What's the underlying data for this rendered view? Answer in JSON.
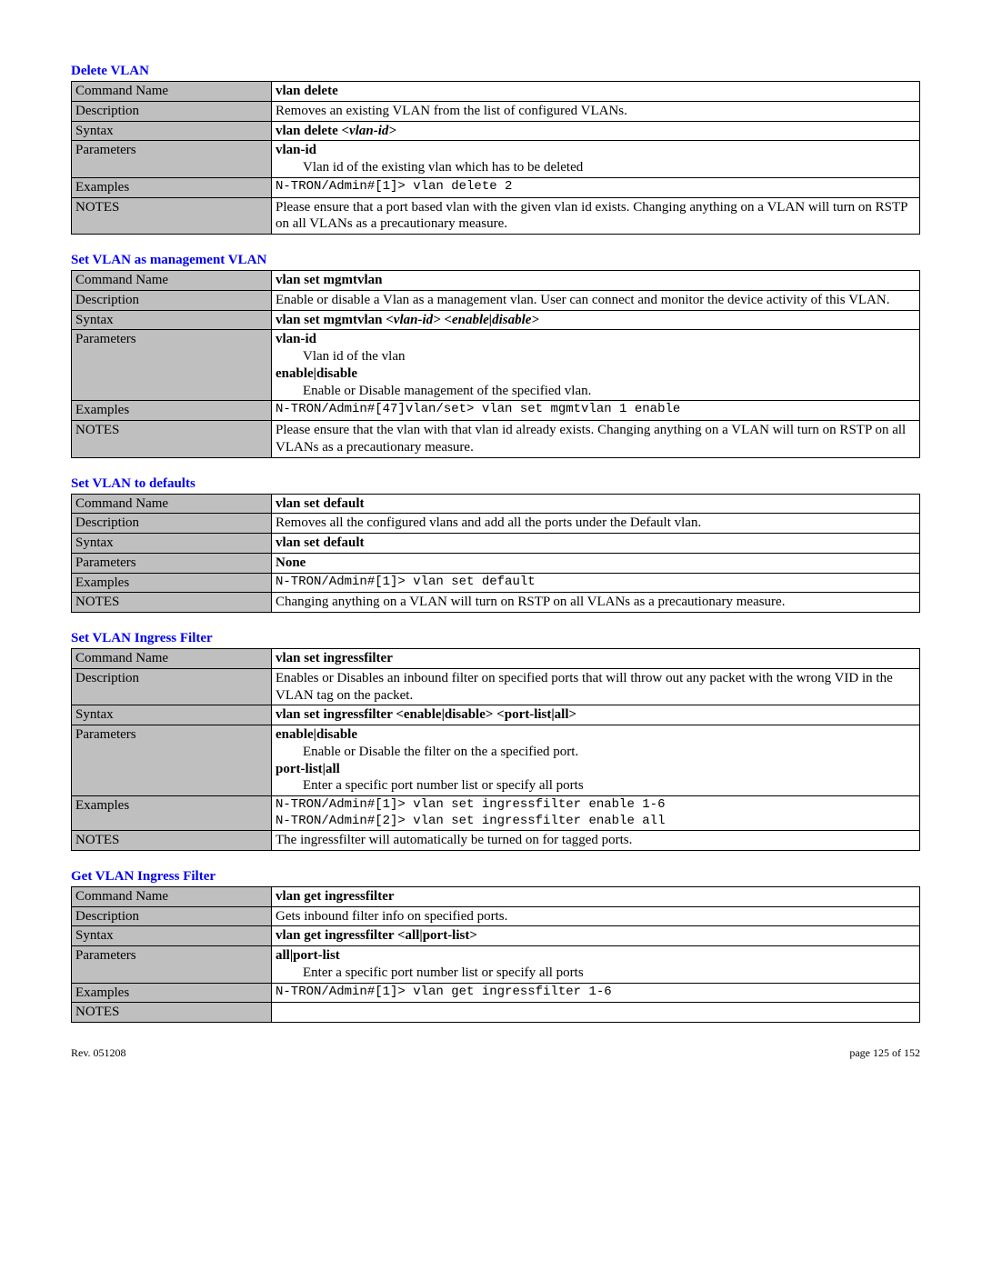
{
  "sections": [
    {
      "title": "Delete VLAN",
      "rows": {
        "cmdLabel": "Command Name",
        "cmd": "vlan delete",
        "descLabel": "Description",
        "desc": "Removes an existing VLAN from the list of configured VLANs.",
        "syntaxLabel": "Syntax",
        "syntaxBold": "vlan delete ",
        "syntaxItal": "<vlan-id>",
        "paramLabel": "Parameters",
        "p1Bold": "vlan-id",
        "p1Text": "Vlan id of the existing vlan which has to be deleted",
        "exLabel": "Examples",
        "ex1": "N-TRON/Admin#[1]> vlan delete 2",
        "notesLabel": "NOTES",
        "notes": "Please ensure that a port based vlan with the given vlan id exists.  Changing anything on a VLAN will turn on RSTP on all VLANs as a precautionary measure."
      }
    },
    {
      "title": "Set VLAN as management VLAN",
      "rows": {
        "cmdLabel": "Command Name",
        "cmd": "vlan set mgmtvlan",
        "descLabel": "Description",
        "desc": "Enable or disable a Vlan as a management vlan. User can connect and monitor the device activity of this VLAN.",
        "syntaxLabel": "Syntax",
        "syntaxBold": "vlan set mgmtvlan ",
        "syntaxItal": "<vlan-id> <enable|disable>",
        "paramLabel": "Parameters",
        "p1Bold": "vlan-id",
        "p1Text": "Vlan id of the vlan",
        "p2Bold": "enable|disable",
        "p2Text": "Enable or Disable management of the specified vlan.",
        "exLabel": "Examples",
        "ex1": "N-TRON/Admin#[47]vlan/set> vlan set mgmtvlan 1 enable",
        "notesLabel": "NOTES",
        "notes": "Please ensure that the vlan with that vlan id already exists.  Changing anything on a VLAN will turn on RSTP on all VLANs as a precautionary measure."
      }
    },
    {
      "title": "Set VLAN to defaults",
      "rows": {
        "cmdLabel": "Command Name",
        "cmd": "vlan set default",
        "descLabel": "Description",
        "desc": "Removes all the configured vlans and add all the ports under the Default vlan.",
        "syntaxLabel": "Syntax",
        "syntaxBold": "vlan set default",
        "paramLabel": "Parameters",
        "p1Bold": "None",
        "exLabel": "Examples",
        "ex1": "N-TRON/Admin#[1]> vlan set default",
        "notesLabel": "NOTES",
        "notes": "Changing anything on a VLAN will turn on RSTP on all VLANs as a precautionary measure."
      }
    },
    {
      "title": "Set VLAN Ingress Filter",
      "rows": {
        "cmdLabel": "Command Name",
        "cmd": "vlan set ingressfilter",
        "descLabel": "Description",
        "desc": "Enables or Disables an inbound filter on specified ports that will throw out any packet with the wrong VID in the VLAN tag on the packet.",
        "syntaxLabel": "Syntax",
        "syntaxBold": "vlan set ingressfilter <enable|disable> <port-list|all>",
        "paramLabel": "Parameters",
        "p1Bold": "enable|disable",
        "p1Text": "Enable or Disable the filter on the a specified port.",
        "p2Bold": "port-list|all",
        "p2Text": "Enter a specific port number list or specify all ports",
        "exLabel": "Examples",
        "ex1": "N-TRON/Admin#[1]> vlan set ingressfilter enable 1-6",
        "ex2": "N-TRON/Admin#[2]> vlan set ingressfilter enable all",
        "notesLabel": "NOTES",
        "notes": "The ingressfilter will automatically be turned on for tagged ports."
      }
    },
    {
      "title": "Get VLAN Ingress Filter",
      "rows": {
        "cmdLabel": "Command Name",
        "cmd": "vlan get ingressfilter",
        "descLabel": "Description",
        "desc": "Gets inbound filter info on specified ports.",
        "syntaxLabel": "Syntax",
        "syntaxBold": "vlan get ingressfilter <all|port-list>",
        "paramLabel": "Parameters",
        "p1Bold": "all|port-list",
        "p1Text": "Enter a specific port number list or specify all ports",
        "exLabel": "Examples",
        "ex1": "N-TRON/Admin#[1]> vlan get ingressfilter 1-6",
        "notesLabel": "NOTES",
        "notes": ""
      }
    }
  ],
  "footer": {
    "left": "Rev.  051208",
    "right": "page 125 of 152"
  }
}
